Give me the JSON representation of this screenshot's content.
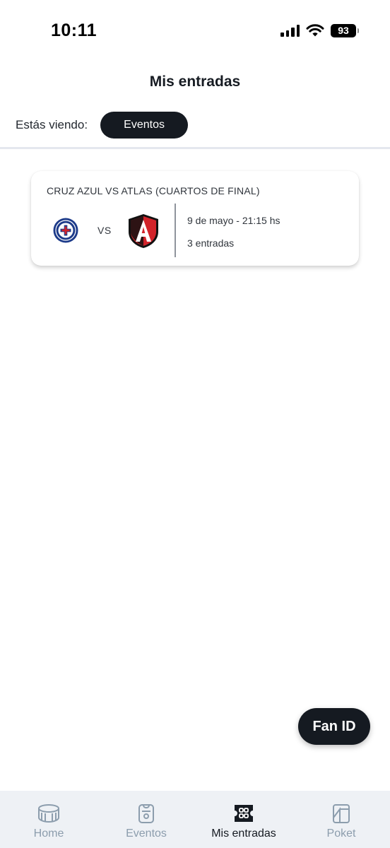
{
  "status_bar": {
    "time": "10:11",
    "battery": "93"
  },
  "header": {
    "title": "Mis entradas"
  },
  "filter": {
    "label": "Estás viendo:",
    "selected": "Eventos"
  },
  "tickets": [
    {
      "title": "CRUZ AZUL VS ATLAS (CUARTOS DE FINAL)",
      "vs": "VS",
      "date": "9 de mayo - 21:15 hs",
      "count": "3 entradas"
    }
  ],
  "fan_id": {
    "label": "Fan ID"
  },
  "nav": {
    "items": [
      {
        "label": "Home",
        "icon": "stadium-icon",
        "active": false
      },
      {
        "label": "Eventos",
        "icon": "ticket-icon",
        "active": false
      },
      {
        "label": "Mis entradas",
        "icon": "tickets-grid-icon",
        "active": true
      },
      {
        "label": "Poket",
        "icon": "wallet-icon",
        "active": false
      }
    ]
  },
  "colors": {
    "primary": "#151a21",
    "nav_inactive": "#8c9dad",
    "nav_bg": "#eef1f5",
    "cruz_azul": "#1d3b8a",
    "atlas_red": "#d2232a"
  }
}
